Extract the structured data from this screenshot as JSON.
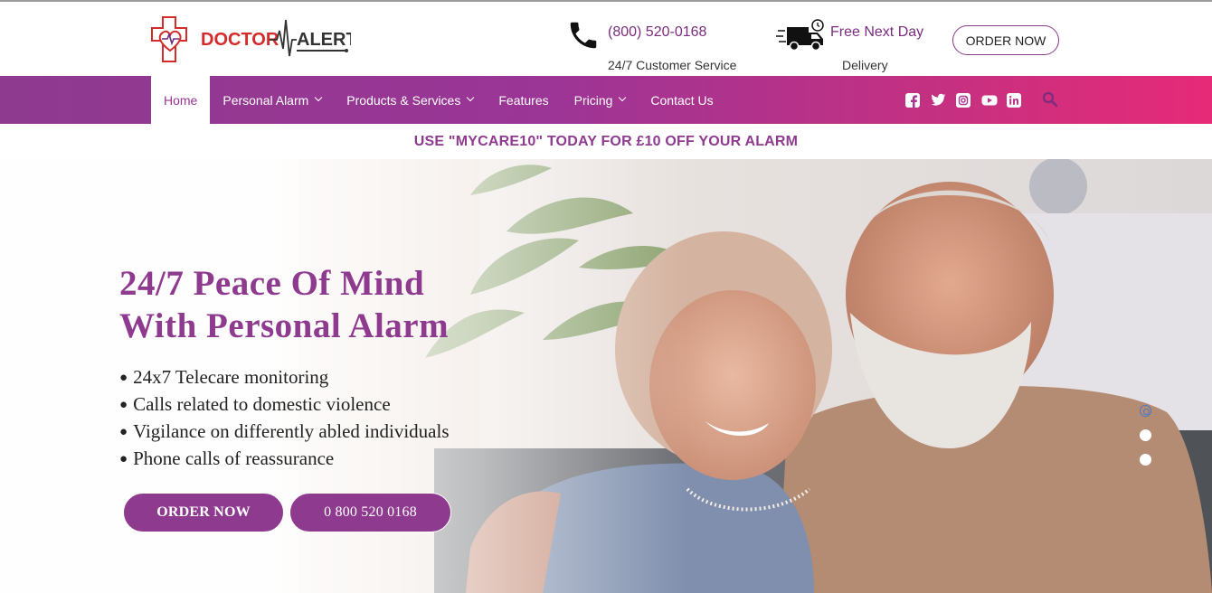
{
  "brand": {
    "logo_text_left": "DOCTOR",
    "logo_text_right": "ALERT",
    "colors": {
      "primary": "#8e3a8f",
      "accent": "#e62a78",
      "logo_red": "#d42b2b"
    }
  },
  "header": {
    "phone_icon": "phone-icon",
    "phone_number": "(800) 520-0168",
    "phone_subtitle": "24/7 Customer Service",
    "truck_icon": "delivery-truck-icon",
    "delivery_line1": "Free Next Day",
    "delivery_line2": "Delivery",
    "order_button": "ORDER NOW"
  },
  "nav": {
    "items": [
      {
        "label": "Home",
        "active": true,
        "dropdown": false
      },
      {
        "label": "Personal Alarm",
        "active": false,
        "dropdown": true
      },
      {
        "label": "Products & Services",
        "active": false,
        "dropdown": true
      },
      {
        "label": "Features",
        "active": false,
        "dropdown": false
      },
      {
        "label": "Pricing",
        "active": false,
        "dropdown": true
      },
      {
        "label": "Contact Us",
        "active": false,
        "dropdown": false
      }
    ],
    "social_icons": [
      "facebook-icon",
      "twitter-icon",
      "instagram-icon",
      "youtube-icon",
      "linkedin-icon"
    ],
    "search_icon": "search-icon"
  },
  "promo": {
    "text": "USE \"MYCARE10\" TODAY FOR £10 OFF YOUR ALARM"
  },
  "hero": {
    "title_line1": "24/7 Peace Of Mind",
    "title_line2": "With Personal Alarm",
    "bullets": [
      "24x7 Telecare monitoring",
      "Calls related to domestic violence",
      "Vigilance on differently abled individuals",
      "Phone calls of reassurance"
    ],
    "order_button": "ORDER NOW",
    "call_button": "0 800 520 0168",
    "slider_dots": 3,
    "active_slide": 1
  }
}
